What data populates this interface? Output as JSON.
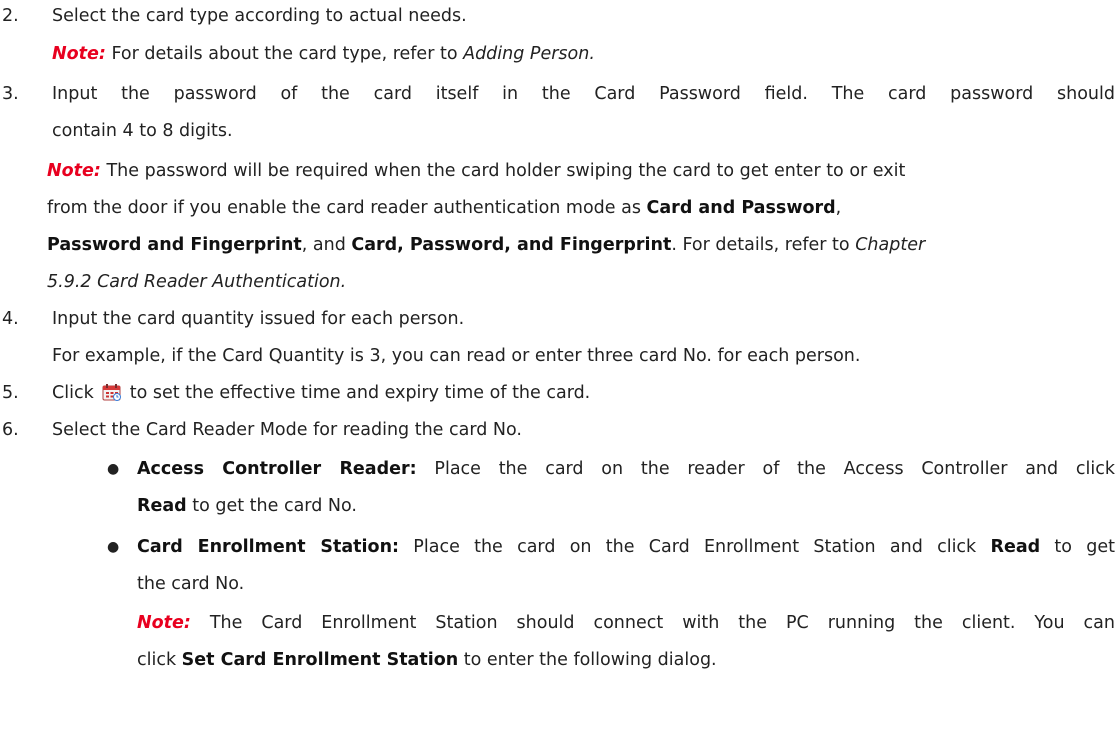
{
  "steps": {
    "s2": {
      "num": "2.",
      "text": "Select the card type according to actual needs.",
      "note_label": "Note:",
      "note_text": " For details about the card type, refer to ",
      "note_link": "Adding Person."
    },
    "s3": {
      "num": "3.",
      "text1": "Input the password of the card itself in the Card Password field. The card password should",
      "text2": "contain 4 to 8 digits.",
      "note_label": "Note:",
      "note_l1": " The password will be required when the card holder swiping the card to get enter to or exit",
      "note_l2a": "from the door if you enable the card reader authentication mode as ",
      "note_l2b": "Card and Password",
      "note_l2c": ",",
      "note_l3a": "Password and Fingerprint",
      "note_l3b": ", and ",
      "note_l3c": "Card, Password, and Fingerprint",
      "note_l3d": ". For details, refer to ",
      "note_l3e": "Chapter",
      "note_l4": "5.9.2 Card Reader Authentication."
    },
    "s4": {
      "num": "4.",
      "text": "Input the card quantity issued for each person.",
      "example": "For example, if the Card Quantity is 3, you can read or enter three card No. for each person."
    },
    "s5": {
      "num": "5.",
      "pre": "Click",
      "icon": "calendar-icon",
      "post": "to set the effective time and expiry time of the card."
    },
    "s6": {
      "num": "6.",
      "text": "Select the Card Reader Mode for reading the card No.",
      "b1_label": "Access Controller Reader:",
      "b1_text1": " Place the card on the reader of the Access Controller and click",
      "b1_read": "Read",
      "b1_text2": " to get the card No.",
      "b2_label": "Card Enrollment Station:",
      "b2_text1": " Place the card on the Card Enrollment Station and click ",
      "b2_read": "Read",
      "b2_text1b": " to get",
      "b2_text2": "the card No.",
      "note_label": "Note:",
      "note_l1": " The Card Enrollment Station should connect with the PC running the client. You can",
      "note_l2a": "click ",
      "note_l2b": "Set Card Enrollment Station",
      "note_l2c": " to enter the following dialog."
    }
  },
  "colors": {
    "note": "#e8001f",
    "text": "#222222"
  }
}
